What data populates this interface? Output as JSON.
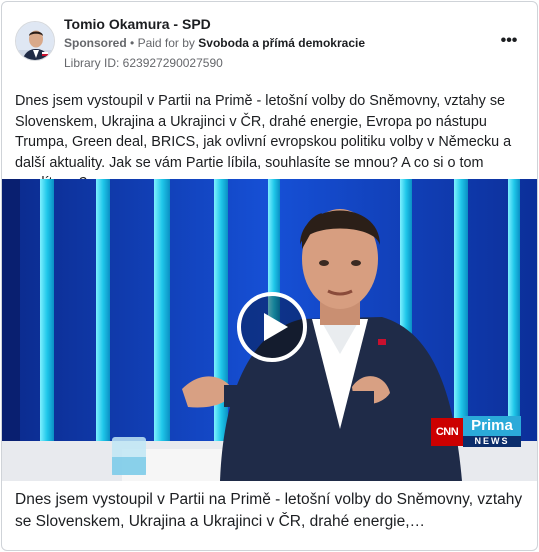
{
  "header": {
    "page_name": "Tomio Okamura - SPD",
    "sponsored_label": "Sponsored",
    "separator": "•",
    "paid_for_prefix": "Paid for by",
    "funder": "Svoboda a přímá demokracie",
    "library_id": "Library ID: 623927290027590",
    "more_icon": "more-dots-icon",
    "more_label": "•••"
  },
  "post": {
    "text": "Dnes jsem vystoupil v Partii na Primě - letošní volby do Sněmovny, vztahy se Slovenskem, Ukrajina a Ukrajinci v ČR, drahé energie, Evropa po nástupu Trumpa, Green deal, BRICS, jak ovlivní evropskou politiku volby v Německu a další aktuality. Jak se vám Partie líbila, souhlasíte se mnou? A co si o tom myslíte vy?"
  },
  "video": {
    "play_icon": "play-icon",
    "logo_cnn": "CNN",
    "logo_prima": "Prima",
    "logo_news": "NEWS"
  },
  "caption": {
    "text": "Dnes jsem vystoupil v Partii na Primě - letošní volby do Sněmovny, vztahy se Slovenskem, Ukrajina a Ukrajinci v ČR, drahé energie,…"
  },
  "colors": {
    "studio_blue": "#0e3fb0",
    "studio_cyan": "#22c7e8",
    "text_secondary": "#65676b"
  }
}
